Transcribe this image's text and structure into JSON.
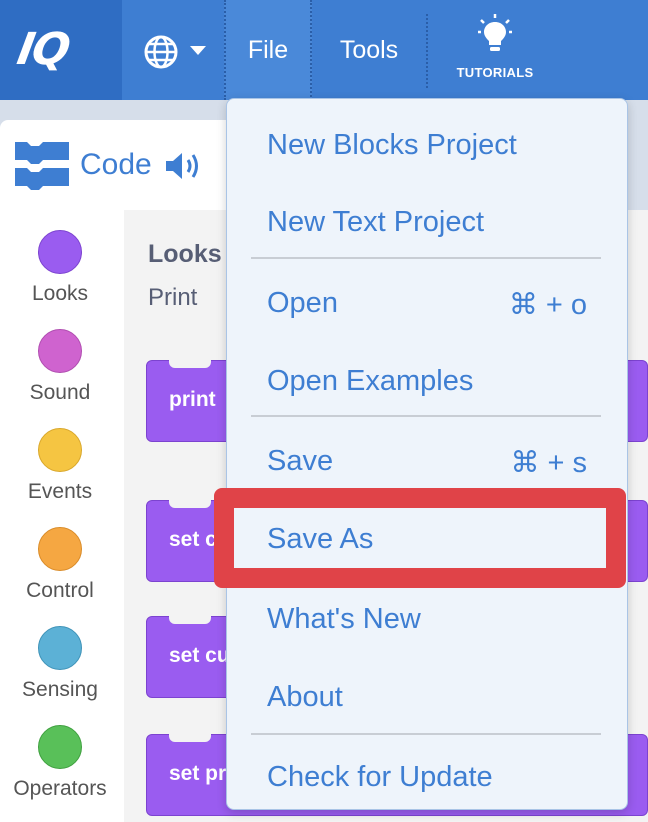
{
  "topbar": {
    "logo_text": "IQ",
    "language_icon": "globe-icon",
    "menus": {
      "file": "File",
      "tools": "Tools"
    },
    "tutorials_label": "TUTORIALS",
    "tutorials_icon": "lightbulb-icon",
    "colors": {
      "bar": "#3e7ed2",
      "logo_bg": "#2f6dc3"
    }
  },
  "code_tab": {
    "label": "Code",
    "icon": "blocks-icon",
    "sound_icon": "speaker-icon"
  },
  "sidebar": {
    "categories": [
      {
        "label": "Looks",
        "color": "#9a5cf0"
      },
      {
        "label": "Sound",
        "color": "#cf63cf"
      },
      {
        "label": "Events",
        "color": "#f5c542"
      },
      {
        "label": "Control",
        "color": "#f5a742"
      },
      {
        "label": "Sensing",
        "color": "#5cb1d6"
      },
      {
        "label": "Operators",
        "color": "#59c059"
      }
    ]
  },
  "palette": {
    "title": "Looks",
    "subtitle": "Print",
    "blocks": [
      {
        "label": "print"
      },
      {
        "label": "set c"
      },
      {
        "label": "set cursor to next row on"
      },
      {
        "label": "set pri"
      }
    ]
  },
  "file_menu": {
    "items": [
      {
        "label": "New Blocks Project",
        "shortcut": ""
      },
      {
        "label": "New Text Project",
        "shortcut": ""
      },
      {
        "label": "Open",
        "shortcut": "⌘ + o"
      },
      {
        "label": "Open Examples",
        "shortcut": ""
      },
      {
        "label": "Save",
        "shortcut": "⌘ + s"
      },
      {
        "label": "Save As",
        "shortcut": ""
      },
      {
        "label": "What's New",
        "shortcut": ""
      },
      {
        "label": "About",
        "shortcut": ""
      },
      {
        "label": "Check for Update",
        "shortcut": ""
      }
    ],
    "highlighted_item": "Save As",
    "highlight_color": "#e04348"
  }
}
